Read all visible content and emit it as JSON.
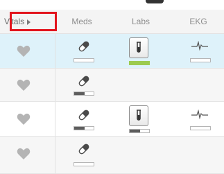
{
  "columns": {
    "vitals": "Vitals",
    "meds": "Meds",
    "labs": "Labs",
    "ekg": "EKG"
  },
  "icons": {
    "vitals_sort": "caret-right-icon",
    "vitals": "heart-icon",
    "meds": "pill-icon",
    "labs": "test-tube-icon",
    "ekg": "ekg-waveform-icon"
  },
  "colors": {
    "highlight_box": "#e2141d",
    "selected_row": "#def2fa",
    "labs_status": "#9ccb4f"
  },
  "rows": [
    {
      "selected": true,
      "meds_progress": 0,
      "labs": "green",
      "ekg": true
    },
    {
      "selected": false,
      "meds_progress": 0.55,
      "labs": null,
      "ekg": false
    },
    {
      "selected": false,
      "meds_progress": 0.55,
      "labs": 0.55,
      "ekg": true
    },
    {
      "selected": false,
      "meds_progress": 0,
      "labs": null,
      "ekg": false
    }
  ]
}
